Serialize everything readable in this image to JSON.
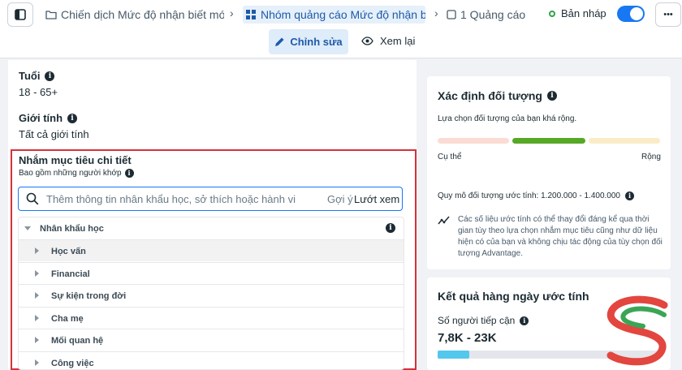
{
  "header": {
    "campaign": "Chiến dịch Mức độ nhận biết mới",
    "ad_set": "Nhóm quảng cáo Mức độ nhận biết",
    "ad": "1 Quảng cáo",
    "status": "Bản nháp",
    "more": "•••",
    "colors": {
      "accent": "#1877f2",
      "status_green": "#31a24c"
    }
  },
  "modes": {
    "edit": "Chỉnh sửa",
    "review": "Xem lại"
  },
  "audience": {
    "age_label": "Tuổi",
    "age_value": "18 - 65+",
    "gender_label": "Giới tính",
    "gender_value": "Tất cả giới tính",
    "detailed_label": "Nhắm mục tiêu chi tiết",
    "include_label": "Bao gồm những người khớp",
    "search_placeholder": "Thêm thông tin nhân khẩu học, sở thích hoặc hành vi",
    "suggestions": "Gợi ý",
    "browse": "Lướt xem",
    "category": "Nhân khẩu học",
    "items": [
      "Học vấn",
      "Financial",
      "Sự kiện trong đời",
      "Cha mẹ",
      "Mối quan hệ",
      "Công việc"
    ]
  },
  "definition": {
    "title": "Xác định đối tượng",
    "desc": "Lựa chọn đối tượng của bạn khá rộng.",
    "specific": "Cụ thể",
    "broad": "Rộng",
    "size": "Quy mô đối tượng ước tính: 1.200.000 - 1.400.000",
    "note": "Các số liệu ước tính có thể thay đổi đáng kể qua thời gian tùy theo lựa chọn nhắm mục tiêu cũng như dữ liệu hiện có của bạn và không chịu tác động của tùy chọn đối tượng Advantage."
  },
  "daily": {
    "title": "Kết quả hàng ngày ước tính",
    "reach_label": "Số người tiếp cận",
    "reach_value": "7,8K - 23K"
  }
}
